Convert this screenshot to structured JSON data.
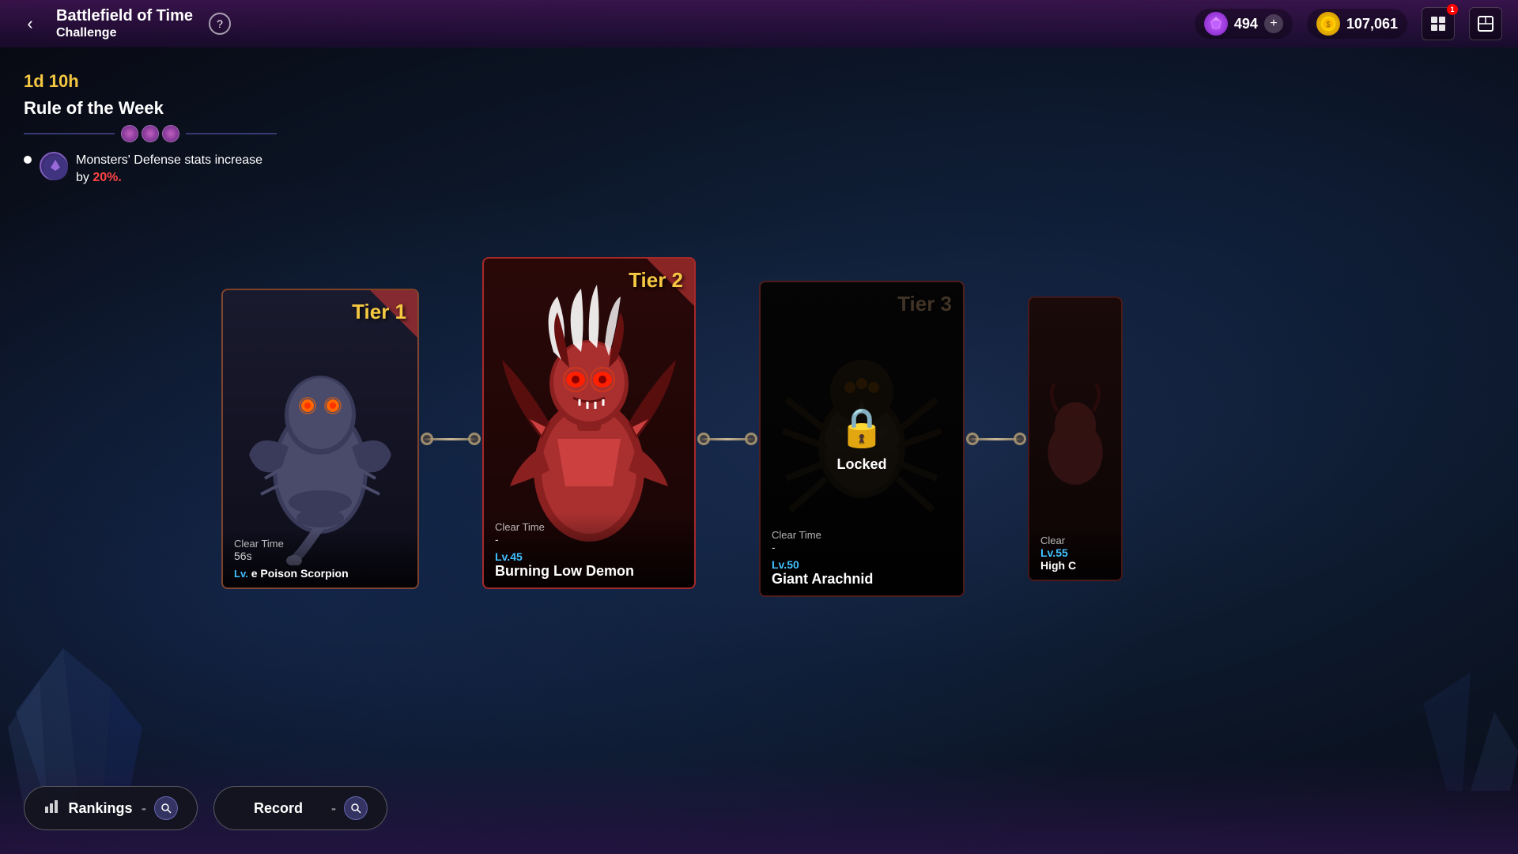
{
  "header": {
    "title_line1": "Battlefield of Time",
    "title_line2": "Challenge",
    "help_label": "?",
    "back_label": "‹",
    "gem_value": "494",
    "coin_value": "107,061",
    "add_label": "+",
    "notification_count": "1"
  },
  "side_panel": {
    "timer": "1d 10h",
    "rule_title": "Rule of the Week",
    "rule_text": "Monsters' Defense stats increase by ",
    "rule_highlight": "20%.",
    "rule_desc": "Monsters' Defense stats increase by 20%."
  },
  "tiers": [
    {
      "id": "tier1",
      "label": "Tier 1",
      "monster_name": "Poison Scorpion",
      "monster_name_prefix": "e ",
      "level": "Lv.",
      "level_num": "",
      "clear_time_label": "Clear Time",
      "clear_time_value": "56s",
      "locked": false,
      "partial": false
    },
    {
      "id": "tier2",
      "label": "Tier 2",
      "monster_name": "Burning Low Demon",
      "level": "Lv.45",
      "clear_time_label": "Clear Time",
      "clear_time_value": "-",
      "locked": false,
      "partial": false
    },
    {
      "id": "tier3",
      "label": "Tier 3",
      "monster_name": "Giant Arachnid",
      "level": "Lv.50",
      "clear_time_label": "Clear Time",
      "clear_time_value": "-",
      "locked": true,
      "lock_text": "Locked",
      "partial": false
    },
    {
      "id": "tier4",
      "label": "",
      "monster_name": "High C",
      "level": "Lv.55",
      "clear_time_label": "Clear",
      "clear_time_value": "",
      "locked": false,
      "partial": true
    }
  ],
  "bottom_bar": {
    "rankings_label": "Rankings",
    "rankings_value": "-",
    "record_label": "Record",
    "record_value": "-"
  }
}
